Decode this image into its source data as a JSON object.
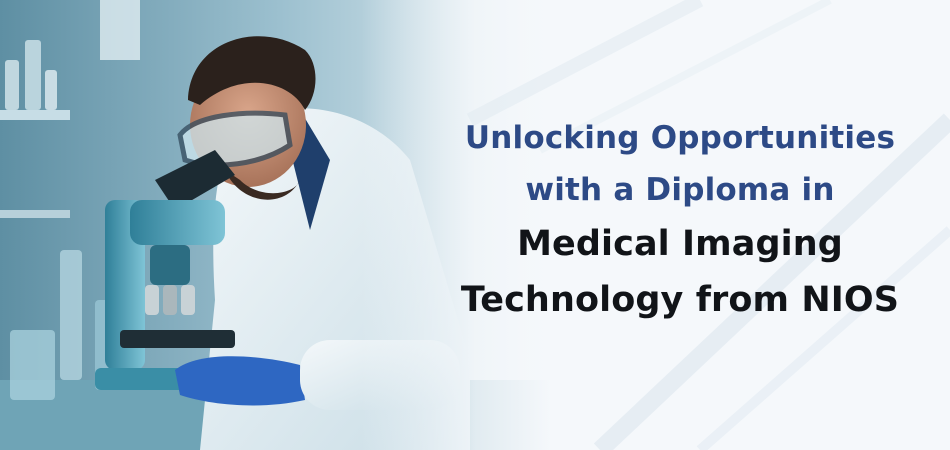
{
  "banner": {
    "headline_line1": "Unlocking Opportunities",
    "headline_line2": "with a Diploma in",
    "headline_line3": "Medical Imaging",
    "headline_line4": "Technology from NIOS"
  },
  "colors": {
    "headline_accent": "#2d4a86",
    "headline_main": "#111418",
    "background": "#f5f8fb",
    "lab_teal": "#3f9bb4"
  },
  "illustration": {
    "subject": "scientist-using-microscope"
  }
}
